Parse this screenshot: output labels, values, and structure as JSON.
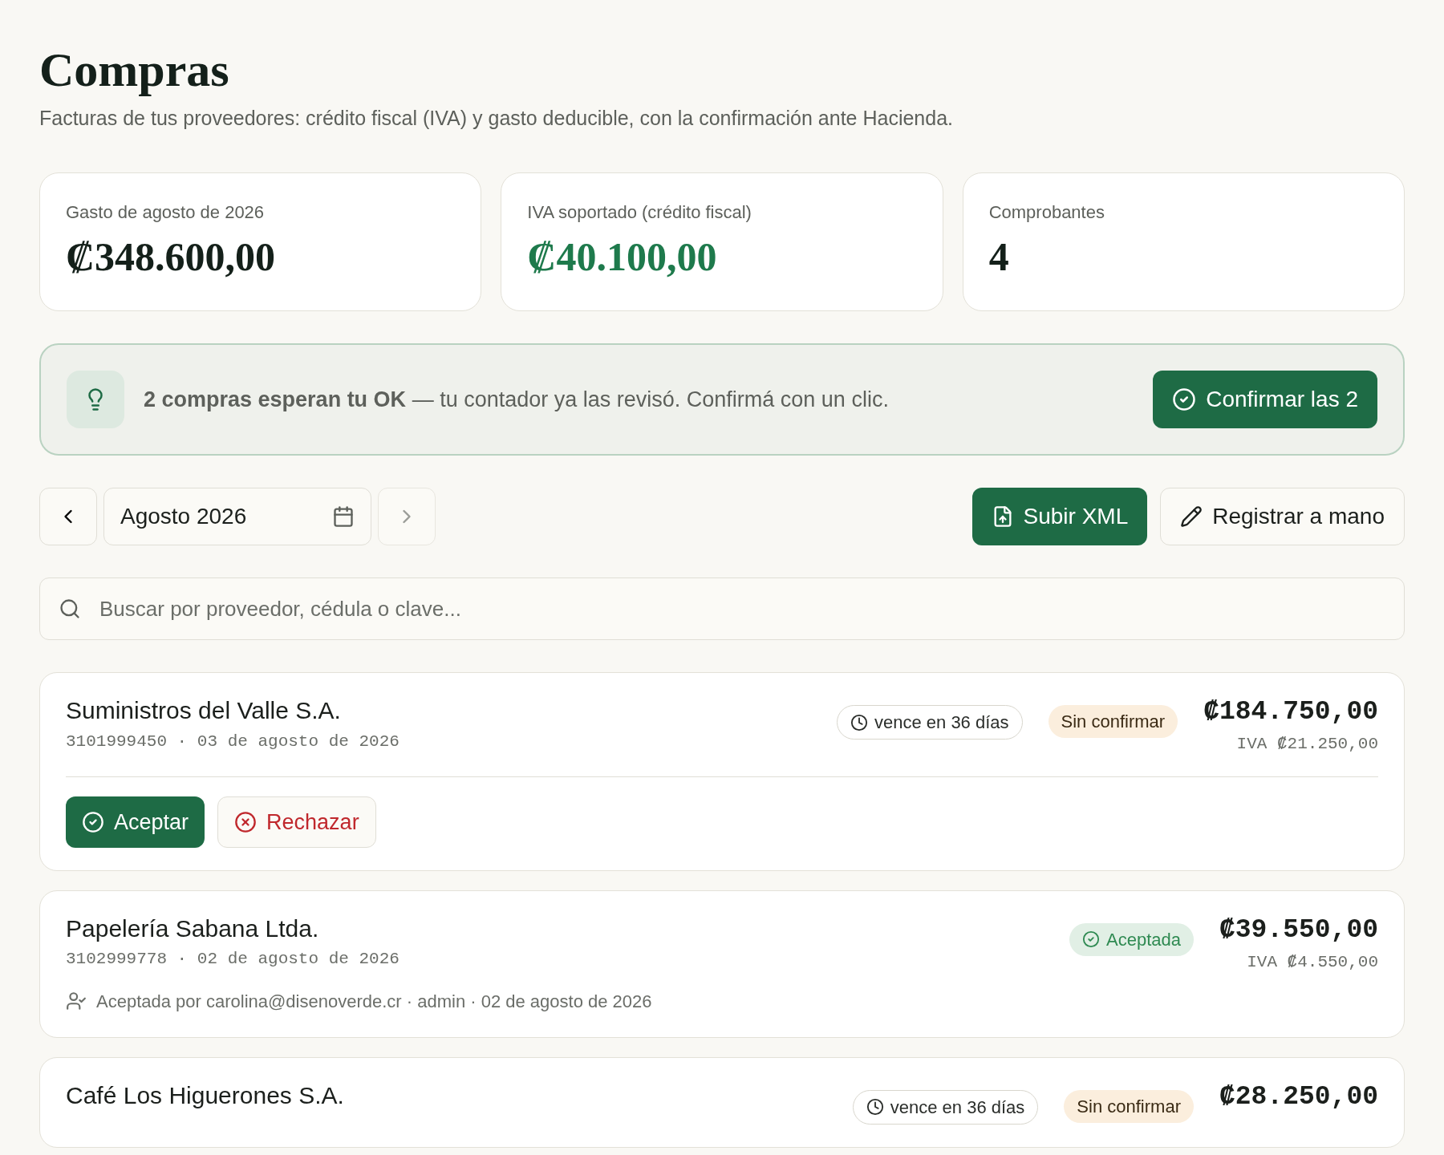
{
  "header": {
    "title": "Compras",
    "subtitle": "Facturas de tus proveedores: crédito fiscal (IVA) y gasto deducible, con la confirmación ante Hacienda."
  },
  "stats": [
    {
      "label": "Gasto de agosto de 2026",
      "value": "₡348.600,00",
      "kind": "plain"
    },
    {
      "label": "IVA soportado (crédito fiscal)",
      "value": "₡40.100,00",
      "kind": "accent"
    },
    {
      "label": "Comprobantes",
      "value": "4",
      "kind": "plain"
    }
  ],
  "banner": {
    "text": "**2 compras esperan tu OK** — tu contador ya las revisó. Confirmá con un clic.",
    "button": "Confirmar las 2"
  },
  "toolbar": {
    "period": "Agosto 2026",
    "upload_button": "Subir XML",
    "manual_button": "Registrar a mano"
  },
  "search": {
    "placeholder": "Buscar por proveedor, cédula o clave..."
  },
  "purchases": [
    {
      "supplier": "Suministros del Valle S.A.",
      "meta": "3101999450 · 03 de agosto de 2026",
      "due": "vence en 36 días",
      "kind": "pending",
      "status_label": "Sin confirmar",
      "amount": "₡184.750,00",
      "tax": "IVA ₡21.250,00",
      "accept_button": "Aceptar",
      "reject_button": "Rechazar"
    },
    {
      "supplier": "Papelería Sabana Ltda.",
      "meta": "3102999778 · 02 de agosto de 2026",
      "kind": "accepted",
      "status_label": "Aceptada",
      "amount": "₡39.550,00",
      "tax": "IVA ₡4.550,00",
      "note": "Aceptada por carolina@disenoverde.cr · admin · 02 de agosto de 2026"
    },
    {
      "supplier": "Café Los Higuerones S.A.",
      "due": "vence en 36 días",
      "kind": "pending",
      "status_label": "Sin confirmar",
      "amount": "₡28.250,00"
    }
  ]
}
